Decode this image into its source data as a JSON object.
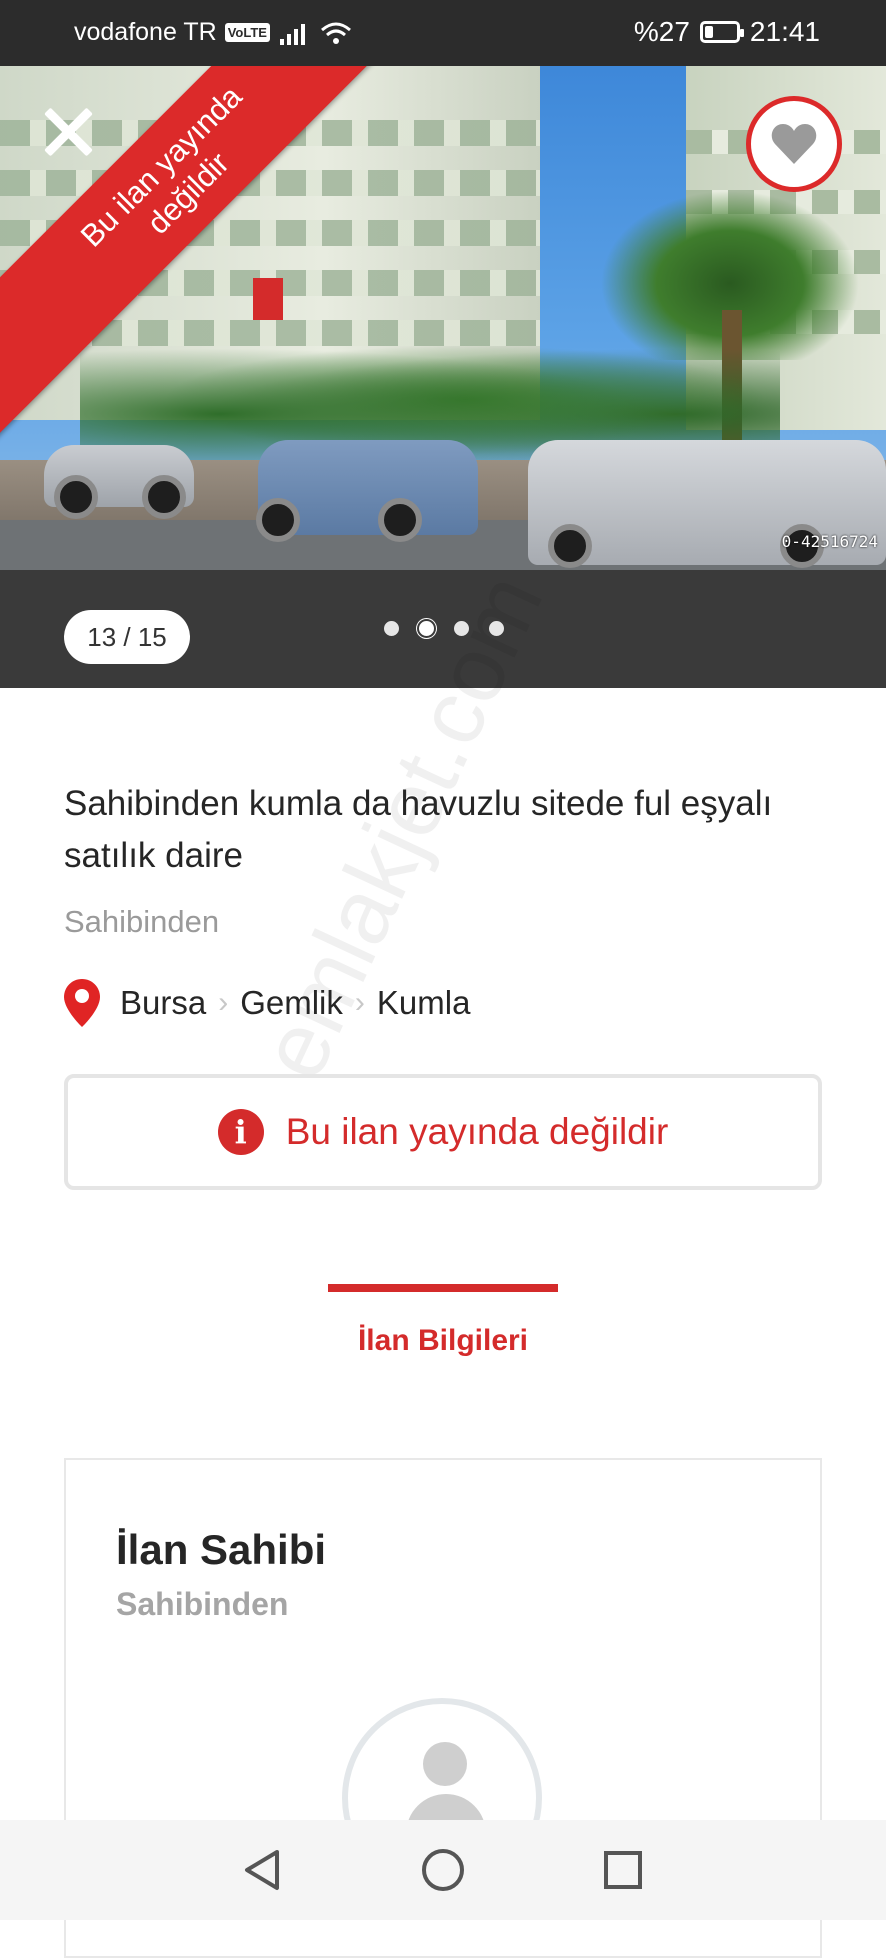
{
  "status_bar": {
    "carrier": "vodafone TR",
    "volte": "VoLTE",
    "battery_percent": "%27",
    "battery_level": 0.27,
    "time": "21:41"
  },
  "gallery": {
    "ribbon_line1": "Bu ilan yayında",
    "ribbon_line2": "değildir",
    "photo_code": "0-42516724",
    "counter": "13 / 15",
    "dot_count": 4,
    "active_dot_index": 1
  },
  "listing": {
    "title": "Sahibinden kumla da havuzlu sitede ful eşyalı  satılık daire",
    "seller_type": "Sahibinden",
    "location": {
      "city": "Bursa",
      "district": "Gemlik",
      "neighborhood": "Kumla"
    },
    "notice": "Bu ilan yayında değildir"
  },
  "tabs": {
    "active_label": "İlan Bilgileri"
  },
  "owner": {
    "title": "İlan Sahibi",
    "subtitle": "Sahibinden"
  },
  "watermark": "emlakjet.com",
  "colors": {
    "accent": "#d42b2b",
    "status_bar_bg": "#2c2c2c",
    "gallery_bar_bg": "#3a3a3a",
    "muted_text": "#9a9a9a"
  }
}
